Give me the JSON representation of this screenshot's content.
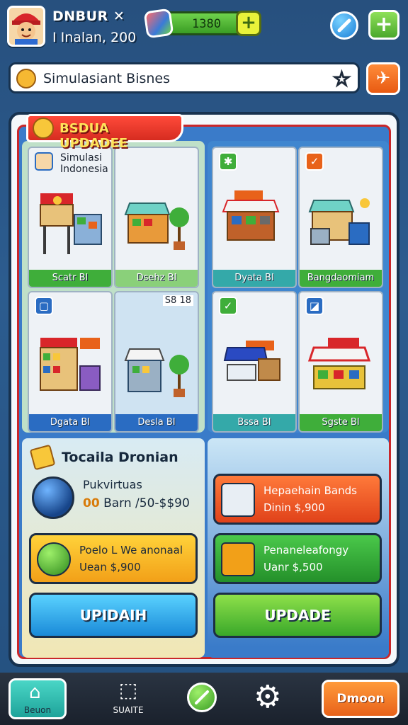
{
  "header": {
    "player_name": "DNBUR ✕",
    "player_sub": "I Inalan, 200",
    "coins": "1380",
    "coin_plus": "+",
    "top_plus": "+"
  },
  "search": {
    "placeholder": "Simulasiant Bisnes",
    "value": "Simulasiant Bisnes"
  },
  "panel": {
    "ribbon": "BSDUA UPDADEE",
    "grid_left_title_line1": "Simulasi",
    "grid_left_title_line2": "Indonesia",
    "sku": "S8 18",
    "cards": [
      {
        "label": "Scatr BI",
        "badge": "",
        "color": "green"
      },
      {
        "label": "Dsehz BI",
        "badge": "",
        "color": "green"
      },
      {
        "label": "Dyata BI",
        "badge": "✱",
        "color": "teal"
      },
      {
        "label": "Bangdaomiam",
        "badge": "✓",
        "color": "green"
      },
      {
        "label": "Dgata BI",
        "badge": "▢",
        "color": "blue"
      },
      {
        "label": "Desla BI",
        "badge": "",
        "color": "blue"
      },
      {
        "label": "Bssa BI",
        "badge": "✓",
        "color": "teal"
      },
      {
        "label": "Sgste BI",
        "badge": "◪",
        "color": "green"
      }
    ]
  },
  "upgrade_left": {
    "title": "Tocaila Dronian",
    "orb_name": "Pukvirtuas",
    "orb_level": "00",
    "orb_price": "Barn /50-$$90",
    "offer_line1": "Poelo L We anonaal",
    "offer_line2": "Uean $,900",
    "button": "UPIDAIH"
  },
  "upgrade_right": {
    "offer1_line1": "Hepaehain Bands",
    "offer1_line2": "Dinin $,900",
    "offer2_line1": "Penaneleafongy",
    "offer2_line2": "Uanr $,500",
    "button": "UPDADE"
  },
  "nav": {
    "home": "Beuon",
    "item2": "SUAITE",
    "cta": "Dmoon"
  },
  "colors": {
    "accent_red": "#d62c20",
    "accent_green": "#3fae3a",
    "accent_orange": "#e8621a",
    "accent_blue": "#2a6cc2"
  },
  "icons": [
    "search-face-icon",
    "star-icon",
    "rocket-icon",
    "home-icon",
    "cube-icon",
    "pencil-icon",
    "gear-icon"
  ]
}
